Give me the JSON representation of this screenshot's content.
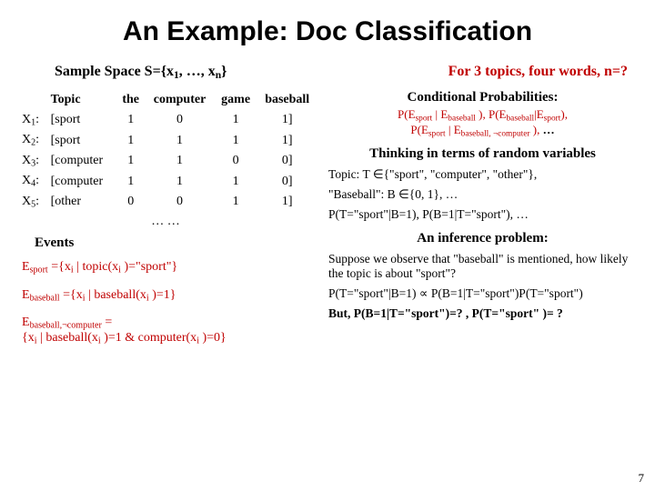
{
  "title": "An Example: Doc Classification",
  "sample_space_label": "Sample Space S={x",
  "sample_space_tail": "}",
  "sample_space_sub1": "1",
  "sample_space_mid": ", …, x",
  "sample_space_subn": "n",
  "right_header": "For 3 topics, four words, n=?",
  "table": {
    "headers": [
      "Topic",
      "the",
      "computer",
      "game",
      "baseball"
    ],
    "rows": [
      {
        "x": "X",
        "xi": "1",
        "topic": "[sport",
        "v": [
          "1",
          "0",
          "1",
          "1]"
        ]
      },
      {
        "x": "X",
        "xi": "2",
        "topic": "[sport",
        "v": [
          "1",
          "1",
          "1",
          "1]"
        ]
      },
      {
        "x": "X",
        "xi": "3",
        "topic": "[computer",
        "v": [
          "1",
          "1",
          "0",
          "0]"
        ]
      },
      {
        "x": "X",
        "xi": "4",
        "topic": "[computer",
        "v": [
          "1",
          "1",
          "1",
          "0]"
        ]
      },
      {
        "x": "X",
        "xi": "5",
        "topic": "[other",
        "v": [
          "0",
          "0",
          "1",
          "1]"
        ]
      }
    ],
    "dots": "…  …"
  },
  "events_label": "Events",
  "events": {
    "e1_a": "E",
    "e1_sub": "sport",
    "e1_b": " ={x",
    "e1_c": " | topic(x",
    "e1_d": " )=\"sport\"}",
    "e2_a": "E",
    "e2_sub": "baseball",
    "e2_b": " ={x",
    "e2_c": " | baseball(x",
    "e2_d": " )=1}",
    "e3_a": "E",
    "e3_sub": "baseball,¬computer",
    "e3_b": " =",
    "e3_line2a": "  {x",
    "e3_line2b": " | baseball(x",
    "e3_line2c": " )=1 & computer(x",
    "e3_line2d": " )=0}"
  },
  "right": {
    "cond_title": "Conditional Probabilities:",
    "cond_line1": "P(E_sport | E_baseball ), P(E_baseball|E_sport),",
    "cond_line2": "P(E_sport | E_baseball, ¬computer ), …",
    "rv_title": "Thinking in terms of random variables",
    "rv_l1": "Topic: T ∈{\"sport\", \"computer\", \"other\"},",
    "rv_l2": "\"Baseball\": B ∈{0, 1}, …",
    "rv_l3": "P(T=\"sport\"|B=1), P(B=1|T=\"sport\"), …",
    "inf_title": "An inference problem:",
    "inf_l1": "Suppose we observe that \"baseball\" is mentioned, how likely the topic is about \"sport\"?",
    "inf_l2": "P(T=\"sport\"|B=1) ∝ P(B=1|T=\"sport\")P(T=\"sport\")",
    "inf_l3": "But, P(B=1|T=\"sport\")=? , P(T=\"sport\" )= ?"
  },
  "page_num": "7"
}
